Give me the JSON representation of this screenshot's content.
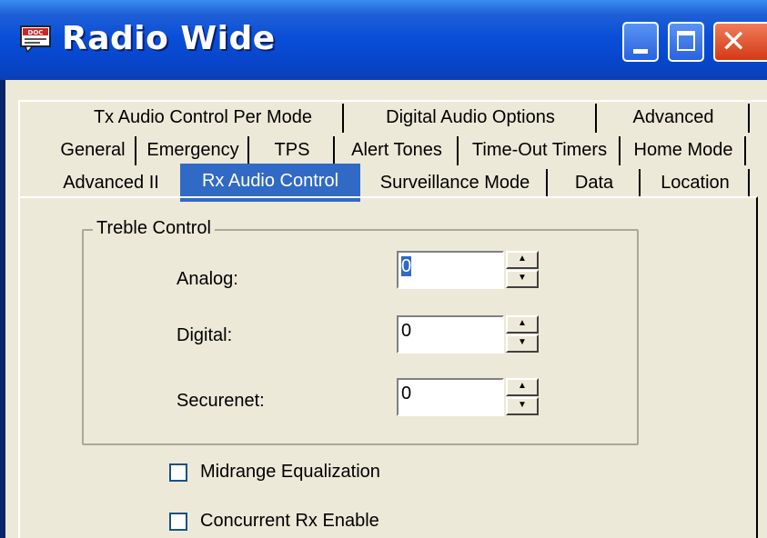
{
  "window": {
    "title": "Radio Wide",
    "app_icon": "doc-icon",
    "buttons": {
      "minimize": "minimize-icon",
      "maximize": "maximize-icon",
      "close": "close-icon"
    }
  },
  "tabs": {
    "row1": [
      "Tx Audio Control Per Mode",
      "Digital Audio Options",
      "Advanced"
    ],
    "row2": [
      "General",
      "Emergency",
      "TPS",
      "Alert Tones",
      "Time-Out Timers",
      "Home Mode"
    ],
    "row3": [
      "Advanced II",
      "Rx Audio Control",
      "Surveillance Mode",
      "Data",
      "Location"
    ],
    "active": "Rx Audio Control"
  },
  "treble": {
    "group_title": "Treble Control",
    "fields": [
      {
        "label": "Analog:",
        "value": "0"
      },
      {
        "label": "Digital:",
        "value": "0"
      },
      {
        "label": "Securenet:",
        "value": "0"
      }
    ]
  },
  "options": [
    {
      "label": "Midrange Equalization",
      "checked": false
    },
    {
      "label": "Concurrent Rx Enable",
      "checked": false
    }
  ],
  "colors": {
    "titlebar": "#0a4fd8",
    "face": "#ece9d8",
    "selection": "#316ac5",
    "close": "#d43a14"
  }
}
